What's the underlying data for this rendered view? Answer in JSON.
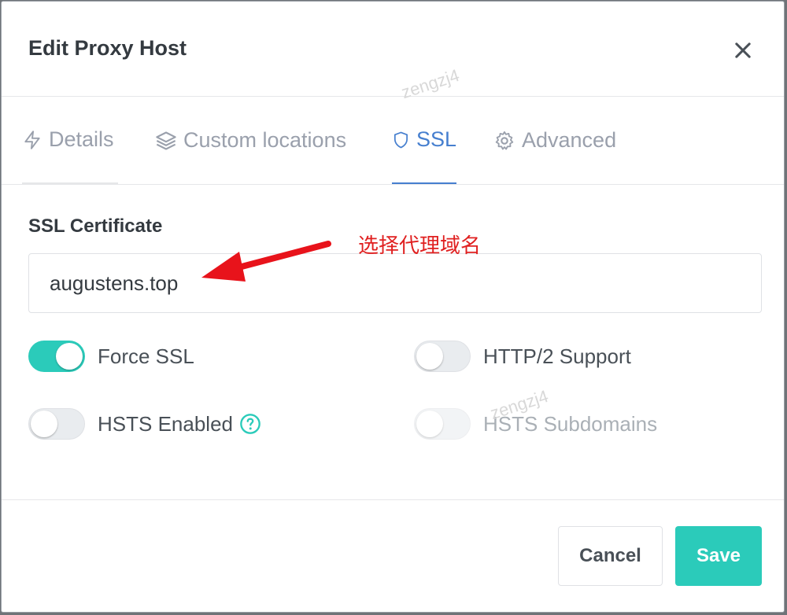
{
  "modal": {
    "title": "Edit Proxy Host"
  },
  "tabs": [
    {
      "label": "Details",
      "icon": "bolt-icon"
    },
    {
      "label": "Custom locations",
      "icon": "layers-icon"
    },
    {
      "label": "SSL",
      "icon": "shield-icon"
    },
    {
      "label": "Advanced",
      "icon": "gear-icon"
    }
  ],
  "ssl": {
    "certificate_label": "SSL Certificate",
    "certificate_value": "augustens.top",
    "annotation": "选择代理域名",
    "toggles": {
      "force_ssl": {
        "label": "Force SSL",
        "on": true
      },
      "http2": {
        "label": "HTTP/2 Support",
        "on": false
      },
      "hsts_enabled": {
        "label": "HSTS Enabled",
        "on": false
      },
      "hsts_subdomains": {
        "label": "HSTS Subdomains",
        "on": false,
        "disabled": true
      }
    }
  },
  "buttons": {
    "cancel": "Cancel",
    "save": "Save"
  },
  "watermark": "zengzj4",
  "colors": {
    "accent": "#2bcbba",
    "active_tab": "#467fcf",
    "annotation": "#e02020"
  }
}
